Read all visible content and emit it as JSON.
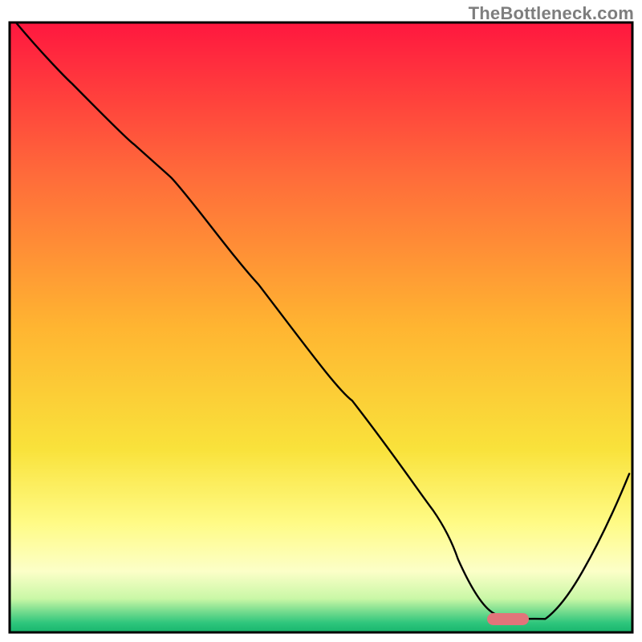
{
  "watermark": {
    "text": "TheBottleneck.com"
  },
  "chart_data": {
    "type": "line",
    "title": "",
    "xlabel": "",
    "ylabel": "",
    "xlim": [
      0,
      100
    ],
    "ylim": [
      0,
      100
    ],
    "grid": false,
    "legend": false,
    "annotations": [],
    "background_gradient": {
      "direction": "vertical",
      "stops": [
        {
          "offset": 0.0,
          "color": "#ff173f"
        },
        {
          "offset": 0.25,
          "color": "#ff6b3a"
        },
        {
          "offset": 0.5,
          "color": "#ffb531"
        },
        {
          "offset": 0.7,
          "color": "#f9e23b"
        },
        {
          "offset": 0.82,
          "color": "#fffb85"
        },
        {
          "offset": 0.9,
          "color": "#fcffc8"
        },
        {
          "offset": 0.945,
          "color": "#c9f7a6"
        },
        {
          "offset": 0.965,
          "color": "#79dd8f"
        },
        {
          "offset": 0.985,
          "color": "#2dc57c"
        },
        {
          "offset": 1.0,
          "color": "#18b56c"
        }
      ]
    },
    "series": [
      {
        "name": "bottleneck-curve",
        "stroke": "#000000",
        "stroke_width": 2.2,
        "x": [
          1.0,
          10.0,
          20.0,
          26.0,
          40.0,
          55.0,
          68.0,
          72.0,
          78.0,
          82.0,
          86.0,
          92.0,
          99.5
        ],
        "y": [
          100.0,
          90.0,
          80.0,
          74.5,
          57.0,
          38.0,
          20.0,
          12.0,
          3.0,
          2.2,
          2.2,
          10.0,
          26.0
        ],
        "note": "y=0 is the bottom green edge; values are read off the plot as percentage of chart height. Curve starts top-left, dips to a flat minimum around x≈80–86 (at the green band), then rises."
      }
    ],
    "marker": {
      "name": "optimal-range-marker",
      "shape": "rounded-bar",
      "color": "#e2747a",
      "x_center": 80.0,
      "y_center": 2.2,
      "width_x": 6.5,
      "height_y": 2.0,
      "note": "Small pink pill sitting on the green band at the curve's minimum."
    }
  }
}
